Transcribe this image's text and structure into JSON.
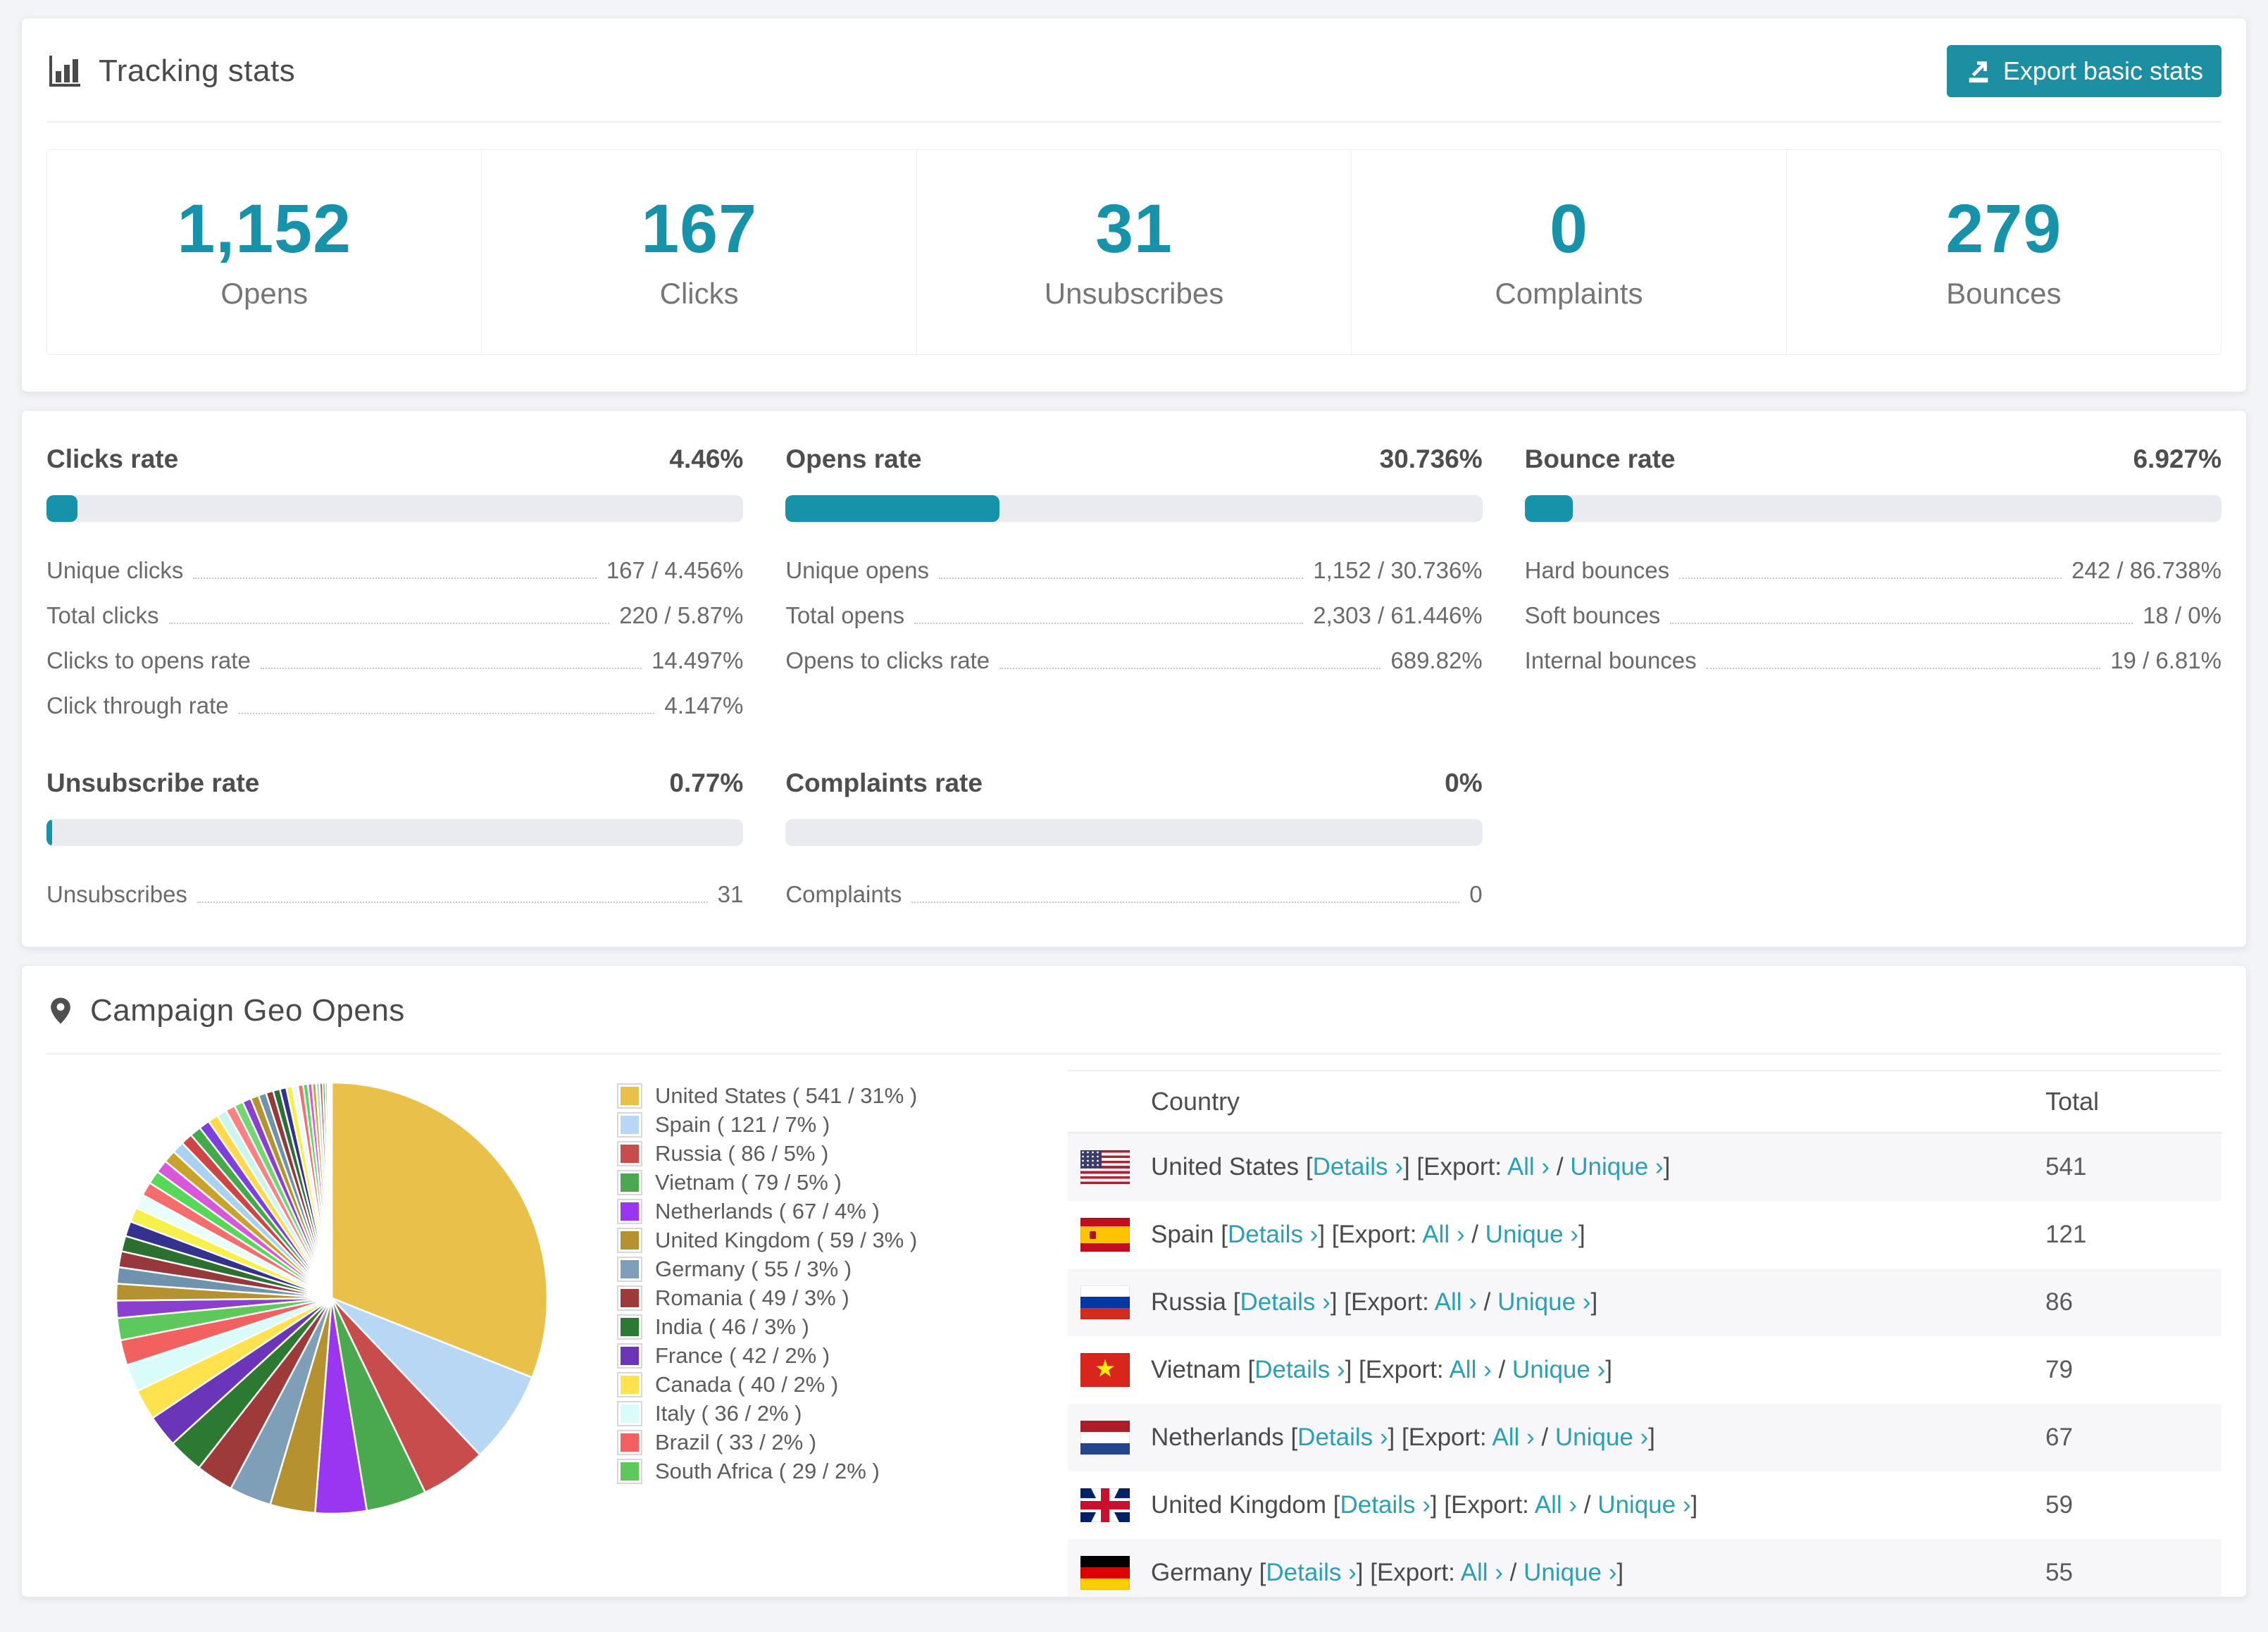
{
  "accent": "#1692aa",
  "tracking": {
    "title": "Tracking stats",
    "export_button": "Export basic stats",
    "summary": [
      {
        "value": "1,152",
        "label": "Opens"
      },
      {
        "value": "167",
        "label": "Clicks"
      },
      {
        "value": "31",
        "label": "Unsubscribes"
      },
      {
        "value": "0",
        "label": "Complaints"
      },
      {
        "value": "279",
        "label": "Bounces"
      }
    ]
  },
  "rates": [
    {
      "title": "Clicks rate",
      "display": "4.46%",
      "percent": 4.46,
      "rows": [
        {
          "label": "Unique clicks",
          "value": "167 / 4.456%"
        },
        {
          "label": "Total clicks",
          "value": "220 / 5.87%"
        },
        {
          "label": "Clicks to opens rate",
          "value": "14.497%"
        },
        {
          "label": "Click through rate",
          "value": "4.147%"
        }
      ]
    },
    {
      "title": "Opens rate",
      "display": "30.736%",
      "percent": 30.736,
      "rows": [
        {
          "label": "Unique opens",
          "value": "1,152 / 30.736%"
        },
        {
          "label": "Total opens",
          "value": "2,303 / 61.446%"
        },
        {
          "label": "Opens to clicks rate",
          "value": "689.82%"
        }
      ]
    },
    {
      "title": "Bounce rate",
      "display": "6.927%",
      "percent": 6.927,
      "rows": [
        {
          "label": "Hard bounces",
          "value": "242 / 86.738%"
        },
        {
          "label": "Soft bounces",
          "value": "18 / 0%"
        },
        {
          "label": "Internal bounces",
          "value": "19 / 6.81%"
        }
      ]
    },
    {
      "title": "Unsubscribe rate",
      "display": "0.77%",
      "percent": 0.77,
      "rows": [
        {
          "label": "Unsubscribes",
          "value": "31"
        }
      ]
    },
    {
      "title": "Complaints rate",
      "display": "0%",
      "percent": 0,
      "rows": [
        {
          "label": "Complaints",
          "value": "0"
        }
      ]
    }
  ],
  "chart_data": {
    "type": "pie",
    "title": "Campaign Geo Opens",
    "legend_position": "right",
    "slices": [
      {
        "label": "United States",
        "value": 541,
        "pct": "31%",
        "color": "#e8c04a"
      },
      {
        "label": "Spain",
        "value": 121,
        "pct": "7%",
        "color": "#b7d7f4"
      },
      {
        "label": "Russia",
        "value": 86,
        "pct": "5%",
        "color": "#c94c4c"
      },
      {
        "label": "Vietnam",
        "value": 79,
        "pct": "5%",
        "color": "#4aa84e"
      },
      {
        "label": "Netherlands",
        "value": 67,
        "pct": "4%",
        "color": "#9a35f0"
      },
      {
        "label": "United Kingdom",
        "value": 59,
        "pct": "3%",
        "color": "#b5922f"
      },
      {
        "label": "Germany",
        "value": 55,
        "pct": "3%",
        "color": "#7f9fb8"
      },
      {
        "label": "Romania",
        "value": 49,
        "pct": "3%",
        "color": "#9e3a3a"
      },
      {
        "label": "India",
        "value": 46,
        "pct": "3%",
        "color": "#2c7a32"
      },
      {
        "label": "France",
        "value": 42,
        "pct": "2%",
        "color": "#6a35b8"
      },
      {
        "label": "Canada",
        "value": 40,
        "pct": "2%",
        "color": "#ffe24d"
      },
      {
        "label": "Italy",
        "value": 36,
        "pct": "2%",
        "color": "#d9fbf9"
      },
      {
        "label": "Brazil",
        "value": 33,
        "pct": "2%",
        "color": "#f2605f"
      },
      {
        "label": "South Africa",
        "value": 29,
        "pct": "2%",
        "color": "#5dc95d"
      }
    ],
    "others_estimated_total": 462,
    "others_slice_count": 40,
    "tail_palette": [
      "#8a3fd1",
      "#b5922f",
      "#6f93ad",
      "#96383c",
      "#2b6f31",
      "#35318f",
      "#f7ef4a",
      "#e9fdfb",
      "#f56d6d",
      "#58d858",
      "#d957d9",
      "#c9a22b",
      "#a9d2f0",
      "#cf4444",
      "#43a949",
      "#7d3fe0",
      "#ffd94d",
      "#ccf5ee",
      "#ff8080",
      "#73d673"
    ]
  },
  "geo": {
    "title": "Campaign Geo Opens",
    "table": {
      "headers": [
        "Country",
        "Total"
      ],
      "link_details": "Details ›",
      "bracket_open": "[",
      "bracket_close": "]",
      "link_export_prefix": "[Export: ",
      "link_separator": " / ",
      "link_all": "All ›",
      "link_unique": "Unique ›",
      "rows": [
        {
          "flag": "us",
          "country": "United States",
          "total": "541"
        },
        {
          "flag": "es",
          "country": "Spain",
          "total": "121"
        },
        {
          "flag": "ru",
          "country": "Russia",
          "total": "86"
        },
        {
          "flag": "vn",
          "country": "Vietnam",
          "total": "79"
        },
        {
          "flag": "nl",
          "country": "Netherlands",
          "total": "67"
        },
        {
          "flag": "gb",
          "country": "United Kingdom",
          "total": "59"
        },
        {
          "flag": "de",
          "country": "Germany",
          "total": "55"
        }
      ]
    }
  }
}
